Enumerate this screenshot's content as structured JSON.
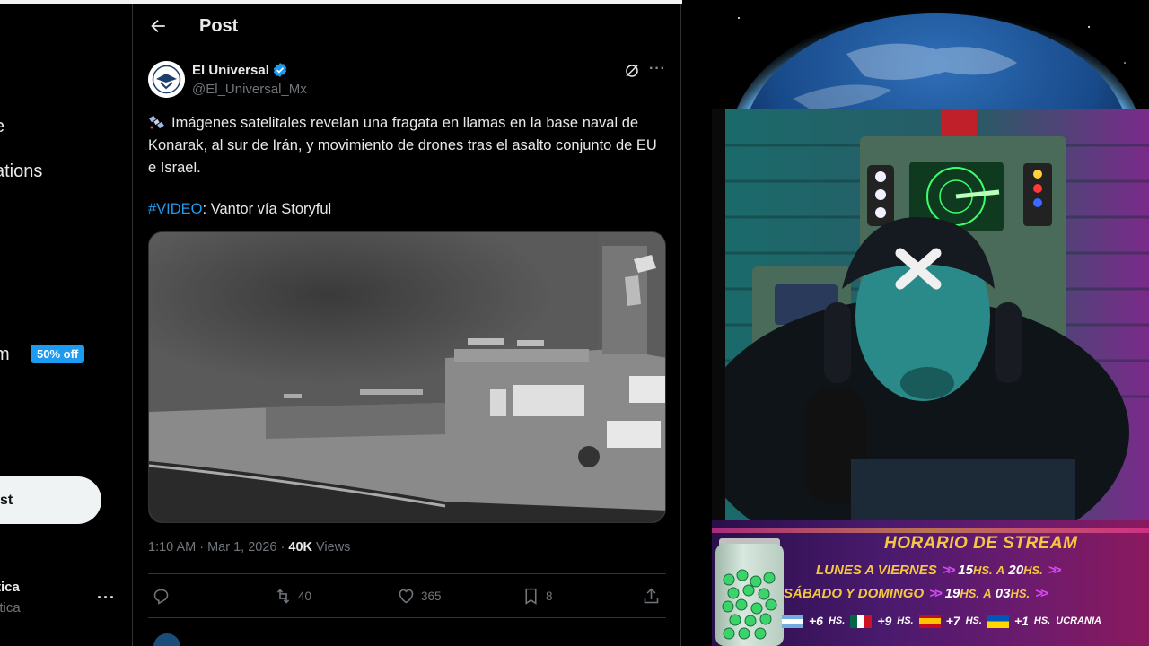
{
  "sidebar": {
    "nav_1": "e",
    "nav_2": "ations",
    "nav_3": "m",
    "offer_badge": "50% off",
    "post_button": "st",
    "account_name": "tica",
    "account_handle": "itica",
    "more": "···"
  },
  "header": {
    "title": "Post",
    "back_icon": "arrow-left-icon"
  },
  "post": {
    "author_name": "El Universal",
    "author_handle": "@El_Universal_Mx",
    "text_main": "Imágenes satelitales revelan una fragata en llamas en la base naval de Konarak, al sur de Irán, y movimiento de drones tras el asalto conjunto de EU e Israel.",
    "hashtag": "#VIDEO",
    "text_credit": ": Vantor vía Storyful",
    "time": "1:10 AM",
    "date": "Mar 1, 2026",
    "views_count": "40K",
    "views_label": "Views",
    "more": "···"
  },
  "actions": {
    "reply_count": "",
    "retweet_count": "40",
    "like_count": "365",
    "bookmark_count": "8"
  },
  "schedule": {
    "title": "HORARIO DE STREAM",
    "row1_days": "LUNES A VIERNES",
    "row1_from": "15",
    "row1_to": "20",
    "row2_days": "SÁBADO Y DOMINGO",
    "row2_from": "19",
    "row2_to": "03",
    "hs": "HS.",
    "a": "A",
    "zone1": "+6",
    "zone2": "+9",
    "zone3": "+7",
    "zone4": "+1",
    "zone4_label": "UCRANIA"
  },
  "colors": {
    "accent": "#1d9bf0",
    "background": "#000000",
    "text": "#e7e9ea",
    "muted": "#71767b",
    "schedule_gold": "#f5c642"
  }
}
